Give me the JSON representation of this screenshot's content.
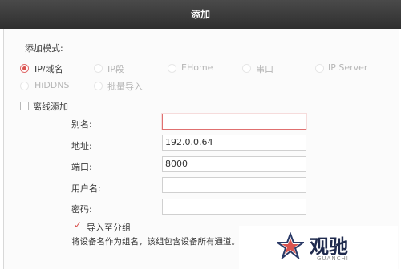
{
  "window": {
    "title": "添加"
  },
  "form": {
    "mode_label": "添加模式:",
    "modes": [
      {
        "label": "IP/域名",
        "selected": true,
        "enabled": true
      },
      {
        "label": "IP段",
        "selected": false,
        "enabled": false
      },
      {
        "label": "EHome",
        "selected": false,
        "enabled": false
      },
      {
        "label": "串口",
        "selected": false,
        "enabled": false
      },
      {
        "label": "IP Server",
        "selected": false,
        "enabled": false
      },
      {
        "label": "HiDDNS",
        "selected": false,
        "enabled": false
      },
      {
        "label": "批量导入",
        "selected": false,
        "enabled": false
      }
    ],
    "offline_label": "离线添加",
    "offline_checked": false,
    "fields": {
      "alias": {
        "label": "别名:",
        "value": ""
      },
      "address": {
        "label": "地址:",
        "value": "192.0.0.64"
      },
      "port": {
        "label": "端口:",
        "value": "8000"
      },
      "username": {
        "label": "用户名:",
        "value": ""
      },
      "password": {
        "label": "密码:",
        "value": ""
      }
    },
    "import_group_label": "导入至分组",
    "import_group_checked": true,
    "hint": "将设备名作为组名，该组包含设备所有通道。"
  },
  "watermark": {
    "name": "观驰",
    "sub": "GUANCHI"
  },
  "colors": {
    "accent": "#d9534f",
    "titlebar": "#3a3a3a",
    "error_border": "#e07070"
  }
}
